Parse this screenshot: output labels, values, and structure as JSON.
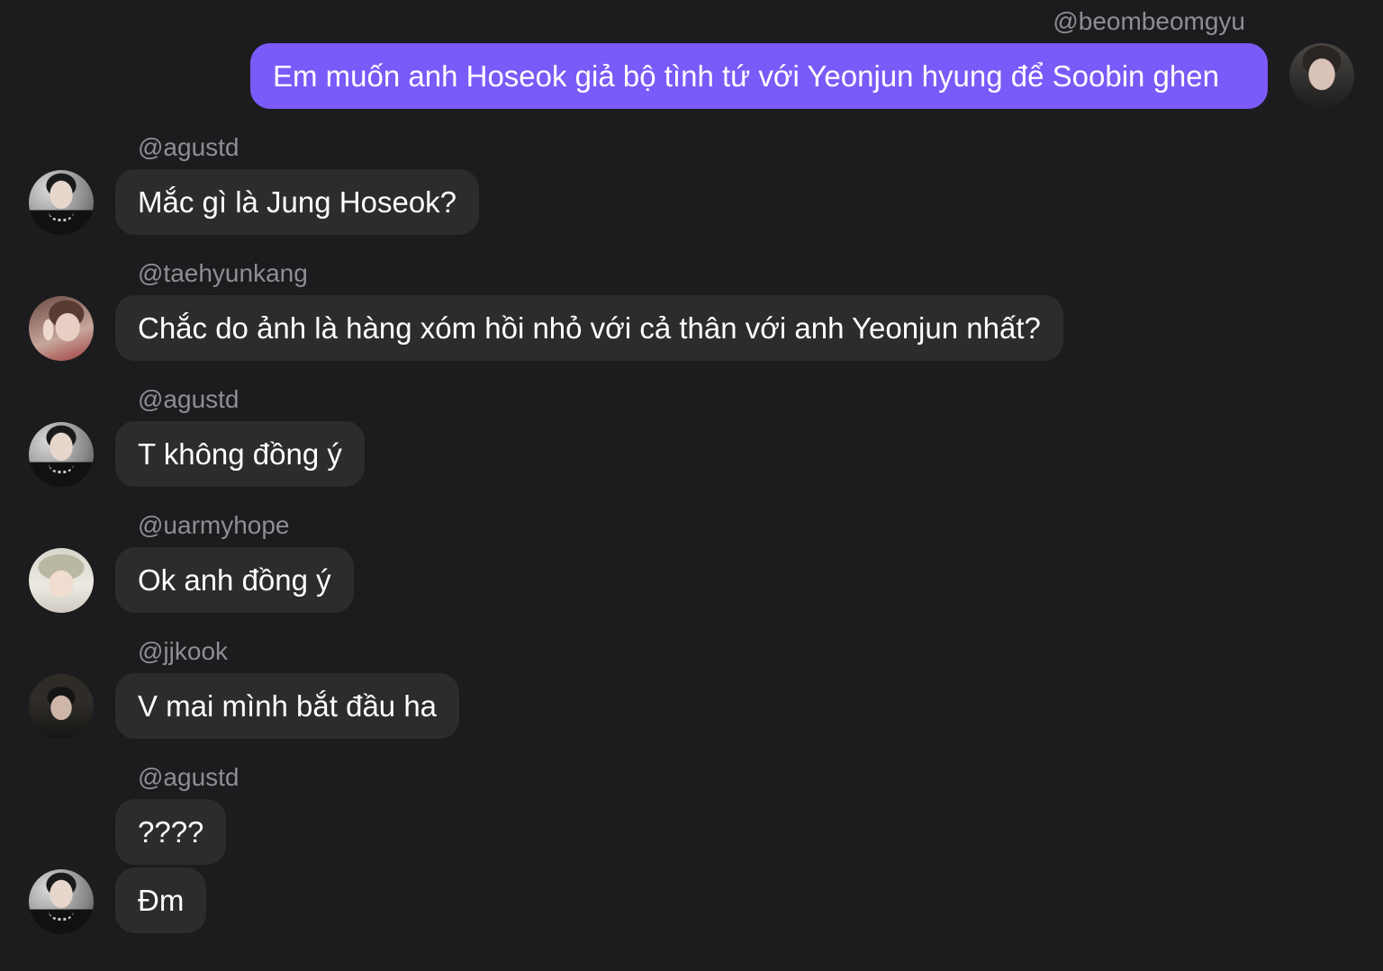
{
  "messages": [
    {
      "sender": "@beombeomgyu",
      "text": "Em muốn anh Hoseok giả bộ tình tứ với Yeonjun hyung để Soobin ghen",
      "direction": "outgoing",
      "avatar": "beomgyu-avatar"
    },
    {
      "sender": "@agustd",
      "text": "Mắc gì là Jung Hoseok?",
      "direction": "incoming",
      "avatar": "agustd-avatar"
    },
    {
      "sender": "@taehyunkang",
      "text": "Chắc do ảnh là hàng xóm hồi nhỏ với cả thân với anh Yeonjun nhất?",
      "direction": "incoming",
      "avatar": "taehyun-avatar"
    },
    {
      "sender": "@agustd",
      "text": "T không đồng ý",
      "direction": "incoming",
      "avatar": "agustd-avatar"
    },
    {
      "sender": "@uarmyhope",
      "text": "Ok anh đồng ý",
      "direction": "incoming",
      "avatar": "uarmyhope-avatar"
    },
    {
      "sender": "@jjkook",
      "text": "V mai mình bắt đầu ha",
      "direction": "incoming",
      "avatar": "jjkook-avatar"
    },
    {
      "sender": "@agustd",
      "texts": [
        "????",
        "Đm"
      ],
      "direction": "incoming",
      "avatar": "agustd-avatar"
    }
  ],
  "colors": {
    "background": "#1c1c1e",
    "outgoing_bubble": "#7a5af8",
    "incoming_bubble": "#2c2c2e",
    "username": "#8e8e93",
    "message_text": "#ffffff"
  }
}
